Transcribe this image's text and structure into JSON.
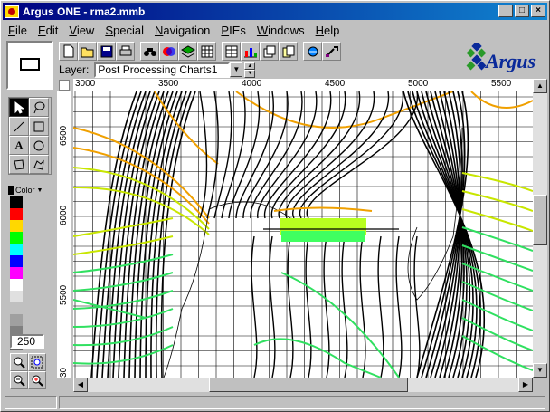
{
  "window": {
    "title": "Argus ONE - rma2.mmb",
    "minimize_label": "_",
    "maximize_label": "□",
    "close_label": "×"
  },
  "menu": [
    {
      "label": "File",
      "accel": "F",
      "rest": "ile"
    },
    {
      "label": "Edit",
      "accel": "E",
      "rest": "dit"
    },
    {
      "label": "View",
      "accel": "V",
      "rest": "iew"
    },
    {
      "label": "Special",
      "accel": "S",
      "rest": "pecial"
    },
    {
      "label": "Navigation",
      "accel": "N",
      "rest": "avigation"
    },
    {
      "label": "PIEs",
      "accel": "P",
      "rest": "IEs"
    },
    {
      "label": "Windows",
      "accel": "W",
      "rest": "indows"
    },
    {
      "label": "Help",
      "accel": "H",
      "rest": "elp"
    }
  ],
  "toolbar": {
    "icons": [
      "new-document-icon",
      "open-folder-icon",
      "save-icon",
      "print-icon",
      "binoculars-icon",
      "color-icon",
      "layers-icon",
      "grid-icon",
      "table-icon",
      "chart-icon",
      "stack-icon",
      "copy-icon",
      "export-icon",
      "tools-icon"
    ]
  },
  "layer": {
    "label": "Layer:",
    "value": "Post Processing Charts1"
  },
  "logo": {
    "text": "Argus"
  },
  "tools": {
    "color_label": "Color",
    "value": "250"
  },
  "palette": [
    "#000000",
    "#ff0000",
    "#ffd800",
    "#00ff00",
    "#00ffff",
    "#0000ff",
    "#ff00ff",
    "#ffffff",
    "#e0e0e0",
    "#c0c0c0",
    "#a0a0a0",
    "#808080",
    "#606060"
  ],
  "ruler": {
    "x_labels": [
      "3000",
      "3500",
      "4000",
      "4500",
      "5000",
      "5500"
    ],
    "y_labels": [
      "6500",
      "6000",
      "5500",
      "30"
    ]
  },
  "colors": {
    "contour_black": "#000000",
    "contour_orange": "#f0a000",
    "contour_yellow": "#c8e600",
    "contour_green": "#30e060"
  }
}
